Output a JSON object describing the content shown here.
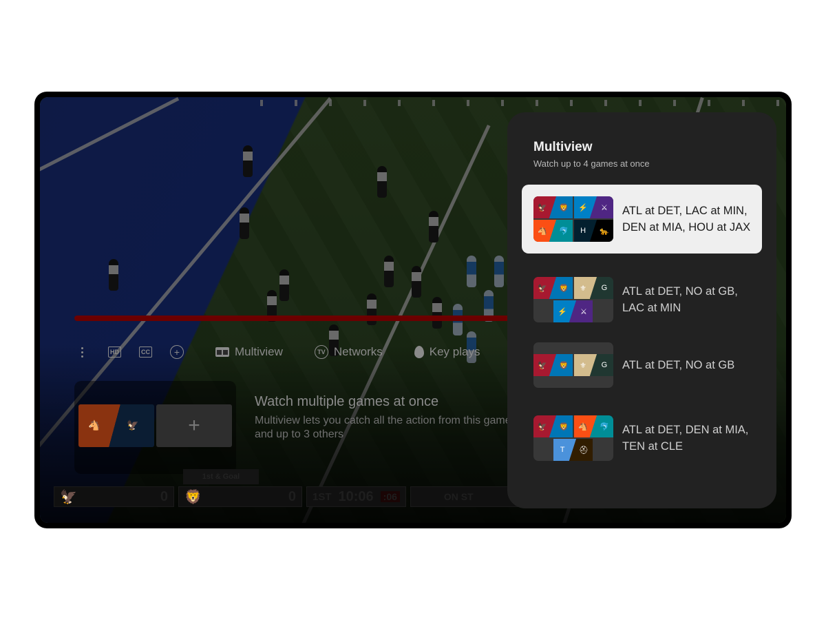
{
  "player": {
    "controls": [
      {
        "id": "more",
        "icon": "more-vert-icon",
        "label": ""
      },
      {
        "id": "hd",
        "icon": "hd-icon",
        "label": "HD"
      },
      {
        "id": "cc",
        "icon": "cc-icon",
        "label": "CC"
      },
      {
        "id": "add",
        "icon": "add-circle-icon",
        "label": "+"
      },
      {
        "id": "multiview",
        "icon": "multiview-icon",
        "label": "Multiview"
      },
      {
        "id": "networks",
        "icon": "tv-icon",
        "label": "Networks",
        "icon_text": "TV"
      },
      {
        "id": "key_plays",
        "icon": "flame-icon",
        "label": "Key plays"
      }
    ],
    "progress_fraction": 1.0,
    "promo": {
      "title": "Watch multiple games at once",
      "description": "Multiview lets you catch all the action from this game and up to 3 others",
      "current_game": [
        "DEN",
        "SEA"
      ],
      "add_label": "+"
    },
    "scorebug": {
      "down_distance": "1st & Goal",
      "away_score": "0",
      "home_score": "0",
      "quarter": "1ST",
      "clock": "10:06",
      "play_clock": ":06",
      "network": "ON ST"
    }
  },
  "multiview_panel": {
    "title": "Multiview",
    "subtitle": "Watch up to 4 games at once",
    "options": [
      {
        "label_line1": "ATL at DET, LAC at MIN,",
        "label_line2": "DEN at MIA, HOU at JAX",
        "selected": true,
        "games": [
          [
            "ATL",
            "DET"
          ],
          [
            "LAC",
            "MIN"
          ],
          [
            "DEN",
            "MIA"
          ],
          [
            "HOU",
            "JAX"
          ]
        ]
      },
      {
        "label_line1": "ATL at DET, NO at GB,",
        "label_line2": "LAC at MIN",
        "selected": false,
        "games": [
          [
            "ATL",
            "DET"
          ],
          [
            "NO",
            "GB"
          ],
          [
            "LAC",
            "MIN"
          ]
        ]
      },
      {
        "label_line1": "ATL at DET, NO at GB",
        "label_line2": "",
        "selected": false,
        "games": [
          [
            "ATL",
            "DET"
          ],
          [
            "NO",
            "GB"
          ]
        ]
      },
      {
        "label_line1": "ATL at DET, DEN at MIA,",
        "label_line2": "TEN at CLE",
        "selected": false,
        "games": [
          [
            "ATL",
            "DET"
          ],
          [
            "DEN",
            "MIA"
          ],
          [
            "TEN",
            "CLE"
          ]
        ]
      }
    ]
  },
  "team_colors": {
    "ATL": "#a71930",
    "DET": "#0076b6",
    "LAC": "#0080c6",
    "MIN": "#4f2683",
    "DEN": "#fb4f14",
    "MIA": "#008e97",
    "HOU": "#03202f",
    "JAX": "#000000",
    "NO": "#d3bc8d",
    "GB": "#203731",
    "TEN": "#4b92db",
    "CLE": "#311d00",
    "SEA": "#002244"
  },
  "team_glyphs": {
    "ATL": "🦅",
    "DET": "🦁",
    "LAC": "⚡",
    "MIN": "⚔",
    "DEN": "🐴",
    "MIA": "🐬",
    "HOU": "H",
    "JAX": "🐆",
    "NO": "⚜",
    "GB": "G",
    "TEN": "T",
    "CLE": "⛑",
    "SEA": "🦅"
  }
}
